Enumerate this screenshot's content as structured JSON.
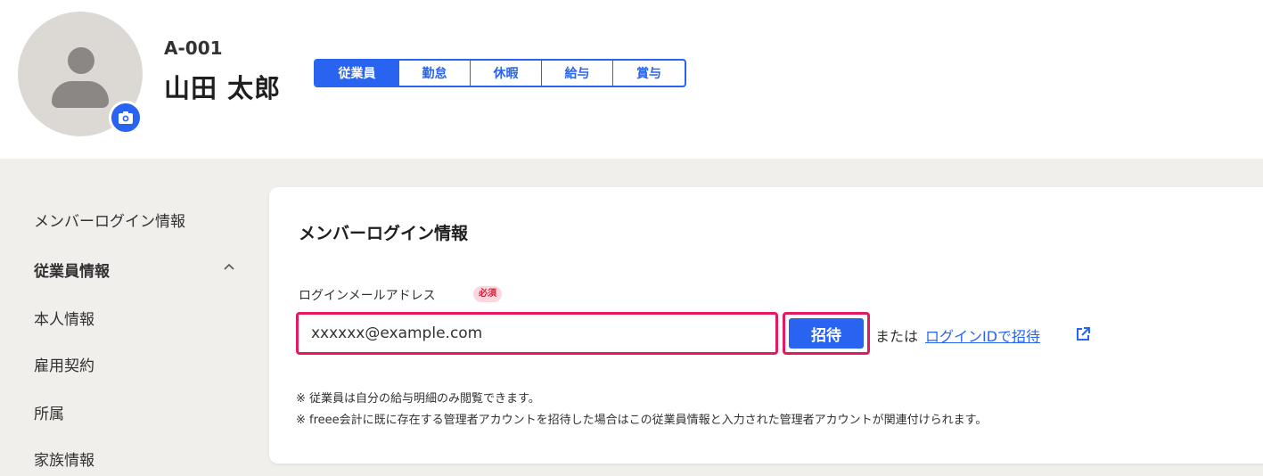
{
  "employee": {
    "code": "A-001",
    "name": "山田 太郎"
  },
  "tabs": [
    {
      "label": "従業員",
      "active": true
    },
    {
      "label": "勤怠",
      "active": false
    },
    {
      "label": "休暇",
      "active": false
    },
    {
      "label": "給与",
      "active": false
    },
    {
      "label": "賞与",
      "active": false
    }
  ],
  "sidebar": {
    "items": [
      {
        "label": "メンバーログイン情報"
      },
      {
        "label": "従業員情報"
      },
      {
        "label": "本人情報"
      },
      {
        "label": "雇用契約"
      },
      {
        "label": "所属"
      },
      {
        "label": "家族情報"
      }
    ]
  },
  "card": {
    "title": "メンバーログイン情報",
    "field_label": "ログインメールアドレス",
    "required_badge": "必須",
    "email_value": "xxxxxx@example.com",
    "invite_label": "招待",
    "or_text": "または",
    "login_id_link": "ログインIDで招待",
    "notes": [
      "※ 従業員は自分の給与明細のみ閲覧できます。",
      "※ freee会計に既に存在する管理者アカウントを招待した場合はこの従業員情報と入力された管理者アカウントが関連付けられます。"
    ]
  },
  "icons": {
    "avatar": "user-avatar-icon",
    "camera": "camera-icon",
    "chevron": "chevron-up-icon",
    "external": "external-link-icon"
  },
  "colors": {
    "accent": "#2864f0",
    "highlight": "#e5195f",
    "page_bg": "#f1efec"
  }
}
